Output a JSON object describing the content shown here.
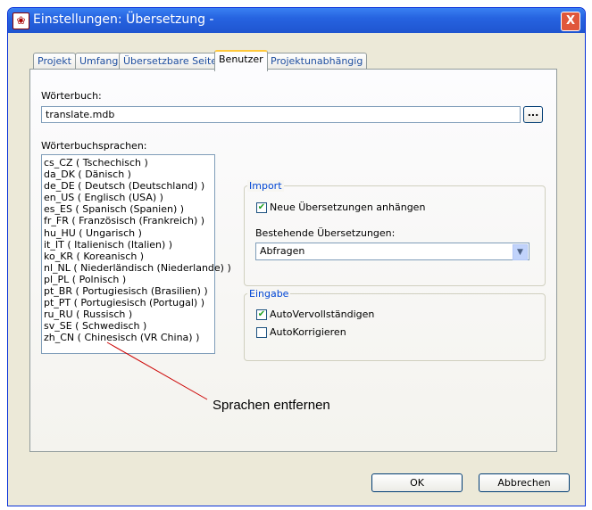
{
  "window": {
    "title": "Einstellungen: Übersetzung -",
    "close": "X"
  },
  "tabs": [
    {
      "label": "Projekt"
    },
    {
      "label": "Umfang"
    },
    {
      "label": "Übersetzbare Seiten"
    },
    {
      "label": "Benutzer",
      "active": true
    },
    {
      "label": "Projektunabhängig"
    }
  ],
  "dictionary": {
    "label": "Wörterbuch:",
    "value": "translate.mdb",
    "browse": "..."
  },
  "languages": {
    "label": "Wörterbuchsprachen:",
    "items": [
      "cs_CZ ( Tschechisch )",
      "da_DK ( Dänisch )",
      "de_DE ( Deutsch (Deutschland) )",
      "en_US ( Englisch (USA) )",
      "es_ES ( Spanisch (Spanien) )",
      "fr_FR ( Französisch (Frankreich) )",
      "hu_HU ( Ungarisch )",
      "it_IT ( Italienisch (Italien) )",
      "ko_KR ( Koreanisch )",
      "nl_NL ( Niederländisch (Niederlande) )",
      "pl_PL ( Polnisch )",
      "pt_BR ( Portugiesisch (Brasilien) )",
      "pt_PT ( Portugiesisch (Portugal) )",
      "ru_RU ( Russisch )",
      "sv_SE ( Schwedisch )",
      "zh_CN ( Chinesisch (VR China) )"
    ]
  },
  "import": {
    "title": "Import",
    "append_label": "Neue Übersetzungen anhängen",
    "append_checked": true,
    "existing_label": "Bestehende Übersetzungen:",
    "existing_value": "Abfragen"
  },
  "input": {
    "title": "Eingabe",
    "autocomplete_label": "AutoVervollständigen",
    "autocomplete_checked": true,
    "autocorrect_label": "AutoKorrigieren",
    "autocorrect_checked": false
  },
  "annotation": {
    "text": "Sprachen entfernen",
    "color": "#CC0000"
  },
  "buttons": {
    "ok": "OK",
    "cancel": "Abbrechen"
  }
}
